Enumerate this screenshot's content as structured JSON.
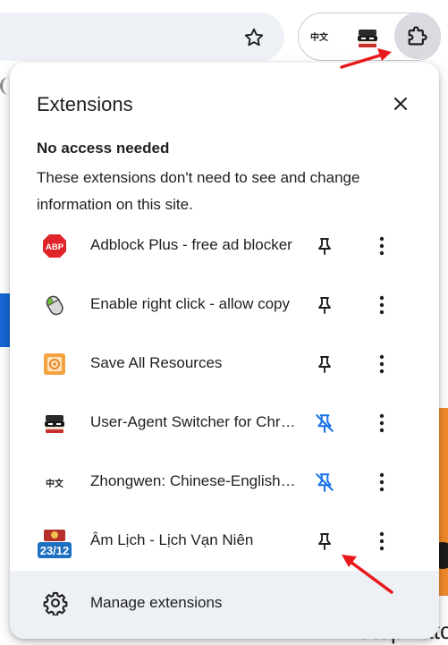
{
  "popup": {
    "title": "Extensions",
    "section_heading": "No access needed",
    "section_description": "These extensions don't need to see and change information on this site.",
    "extensions": [
      {
        "name": "Adblock Plus - free ad blocker",
        "icon": "adblock-plus-icon",
        "icon_text": "ABP",
        "pinned": false
      },
      {
        "name": "Enable right click - allow copy",
        "icon": "mouse-icon",
        "pinned": false
      },
      {
        "name": "Save All Resources",
        "icon": "save-resources-icon",
        "pinned": false
      },
      {
        "name": "User-Agent Switcher for Chrome",
        "icon": "masked-face-icon",
        "pinned": true
      },
      {
        "name": "Zhongwen: Chinese-English Dictionary",
        "icon": "zhongwen-icon",
        "icon_text": "中文",
        "pinned": true
      },
      {
        "name": "Âm Lịch - Lịch Vạn Niên",
        "icon": "calendar-icon",
        "icon_text": "23/12",
        "pinned": false
      }
    ],
    "footer": {
      "label": "Manage extensions",
      "icon": "gear-icon"
    }
  },
  "toolbar": {
    "bookmark_icon": "star-icon",
    "pinned_zhongwen_text": "中文",
    "extensions_button_icon": "puzzle-icon"
  },
  "page": {
    "bottom_text": "Stopwatc"
  },
  "colors": {
    "annotation_red": "#e8191c",
    "pin_active_blue": "#1a73e8",
    "footer_bg": "#edf0f5",
    "abp_red": "#e0242b"
  }
}
